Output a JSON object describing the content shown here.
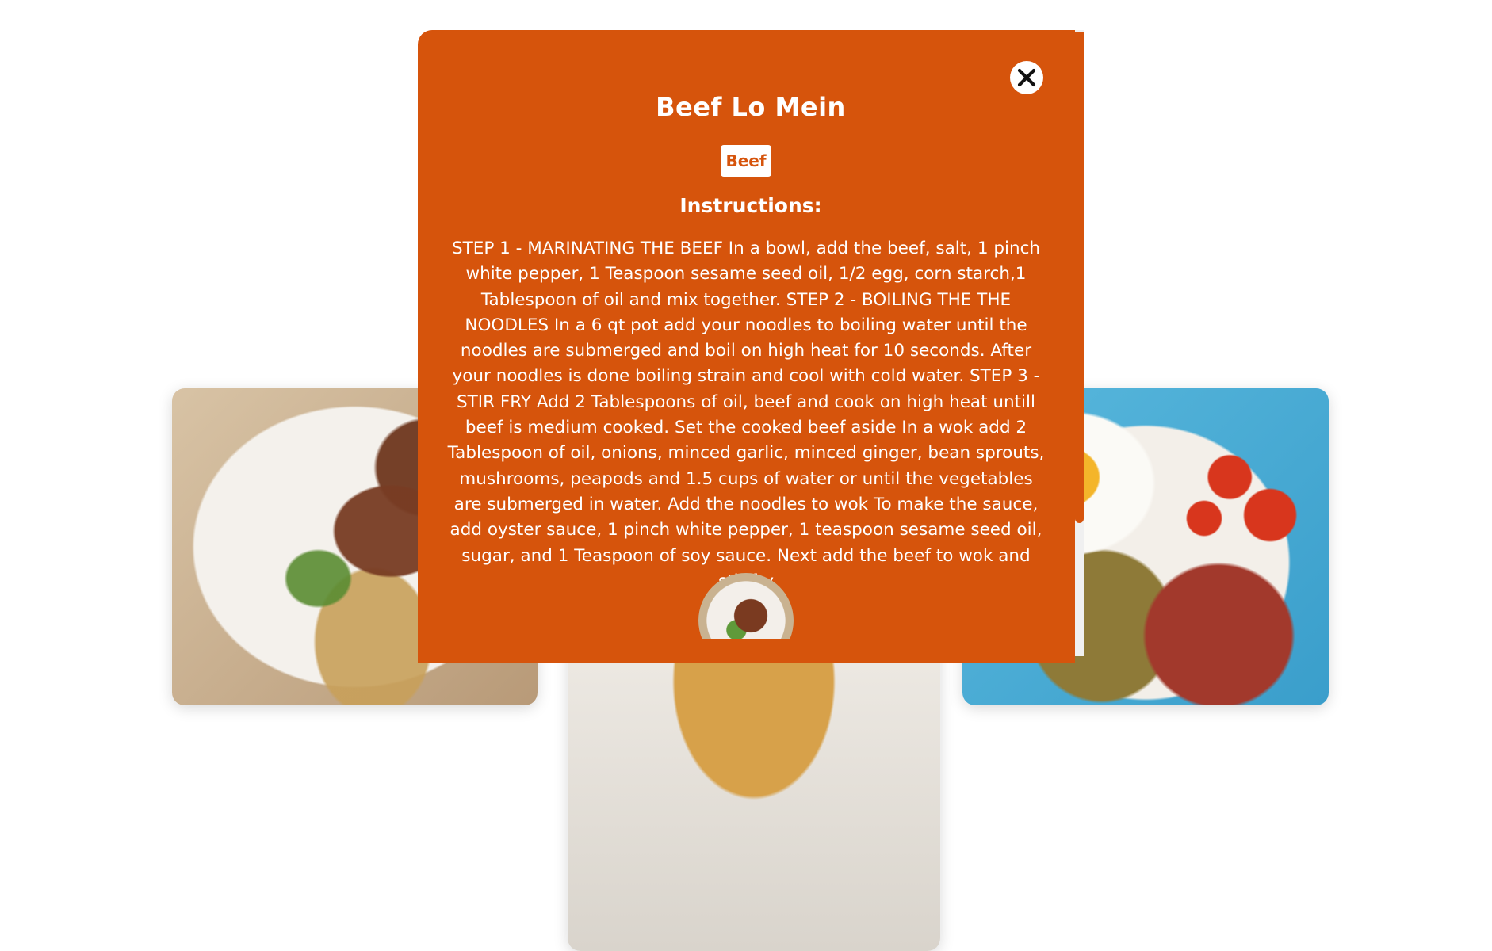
{
  "cards": [
    {
      "image": "beef-stir-fry-photo"
    },
    {
      "image": "pancake-photo"
    },
    {
      "image": "english-breakfast-photo"
    }
  ],
  "modal": {
    "title": "Beef Lo Mein",
    "category": "Beef",
    "instructions_heading": "Instructions:",
    "instructions": "STEP 1 - MARINATING THE BEEF In a bowl, add the beef, salt, 1 pinch white pepper, 1 Teaspoon sesame seed oil, 1/2 egg, corn starch,1 Tablespoon of oil and mix together. STEP 2 - BOILING THE THE NOODLES In a 6 qt pot add your noodles to boiling water until the noodles are submerged and boil on high heat for 10 seconds. After your noodles is done boiling strain and cool with cold water. STEP 3 - STIR FRY Add 2 Tablespoons of oil, beef and cook on high heat untill beef is medium cooked. Set the cooked beef aside In a wok add 2 Tablespoon of oil, onions, minced garlic, minced ginger, bean sprouts, mushrooms, peapods and 1.5 cups of water or until the vegetables are submerged in water. Add the noodles to wok To make the sauce, add oyster sauce, 1 pinch white pepper, 1 teaspoon sesame seed oil, sugar, and 1 Teaspoon of soy sauce. Next add the beef to wok and stir-fry",
    "close_icon": "close-icon"
  },
  "colors": {
    "modal_bg": "#d6540c",
    "text": "#ffffff",
    "badge_bg": "#ffffff",
    "badge_text": "#d6540c"
  }
}
